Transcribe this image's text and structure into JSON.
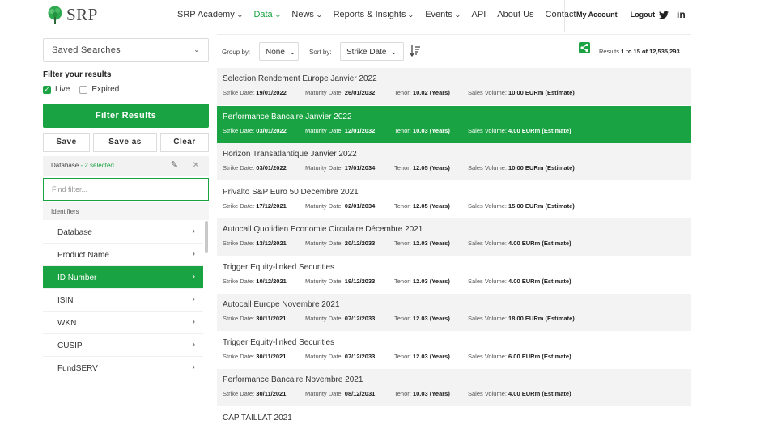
{
  "header": {
    "logo_text": "SRP",
    "nav": [
      {
        "label": "SRP Academy",
        "caret": true,
        "active": false
      },
      {
        "label": "Data",
        "caret": true,
        "active": true
      },
      {
        "label": "News",
        "caret": true,
        "active": false
      },
      {
        "label": "Reports & Insights",
        "caret": true,
        "active": false
      },
      {
        "label": "Events",
        "caret": true,
        "active": false
      },
      {
        "label": "API",
        "caret": false,
        "active": false
      },
      {
        "label": "About Us",
        "caret": false,
        "active": false
      },
      {
        "label": "Contact",
        "caret": false,
        "active": false
      }
    ],
    "my_account": "My Account",
    "logout": "Logout",
    "twitter_glyph": "🐦",
    "linkedin_glyph": "in"
  },
  "sidebar": {
    "saved_searches": "Saved Searches",
    "filter_title": "Filter your results",
    "live_label": "Live",
    "live_checked": true,
    "expired_label": "Expired",
    "expired_checked": false,
    "filter_button": "Filter Results",
    "save_label": "Save",
    "save_as_label": "Save as",
    "clear_label": "Clear",
    "database_label": "Database",
    "database_selected": "- 2 selected",
    "find_placeholder": "Find filter...",
    "section_identifiers": "Identifiers",
    "filters": [
      {
        "label": "Database",
        "active": false
      },
      {
        "label": "Product Name",
        "active": false
      },
      {
        "label": "ID Number",
        "active": true
      },
      {
        "label": "ISIN",
        "active": false
      },
      {
        "label": "WKN",
        "active": false
      },
      {
        "label": "CUSIP",
        "active": false
      },
      {
        "label": "FundSERV",
        "active": false
      }
    ]
  },
  "toolbar": {
    "group_by_label": "Group by:",
    "group_by_value": "None",
    "sort_by_label": "Sort by:",
    "sort_by_value": "Strike Date",
    "results_prefix": "Results",
    "results_range": "1 to 15 of 12,535,293"
  },
  "meta_labels": {
    "strike": "Strike Date:",
    "maturity": "Maturity Date:",
    "tenor": "Tenor:",
    "volume": "Sales Volume:"
  },
  "results": [
    {
      "title": "Selection Rendement Europe Janvier 2022",
      "strike": "19/01/2022",
      "maturity": "26/01/2032",
      "tenor": "10.02 (Years)",
      "volume": "10.00 EURm (Estimate)",
      "style": "shaded"
    },
    {
      "title": "Performance Bancaire Janvier 2022",
      "strike": "03/01/2022",
      "maturity": "12/01/2032",
      "tenor": "10.03 (Years)",
      "volume": "4.00 EURm (Estimate)",
      "style": "active"
    },
    {
      "title": "Horizon Transatlantique Janvier 2022",
      "strike": "03/01/2022",
      "maturity": "17/01/2034",
      "tenor": "12.05 (Years)",
      "volume": "10.00 EURm (Estimate)",
      "style": "shaded"
    },
    {
      "title": "Privalto S&P Euro 50 Decembre 2021",
      "strike": "17/12/2021",
      "maturity": "02/01/2034",
      "tenor": "12.05 (Years)",
      "volume": "15.00 EURm (Estimate)",
      "style": "plain"
    },
    {
      "title": "Autocall Quotidien Economie Circulaire Décembre 2021",
      "strike": "13/12/2021",
      "maturity": "20/12/2033",
      "tenor": "12.03 (Years)",
      "volume": "4.00 EURm (Estimate)",
      "style": "shaded"
    },
    {
      "title": "Trigger Equity-linked Securities",
      "strike": "10/12/2021",
      "maturity": "19/12/2033",
      "tenor": "12.03 (Years)",
      "volume": "4.00 EURm (Estimate)",
      "style": "plain"
    },
    {
      "title": "Autocall Europe Novembre 2021",
      "strike": "30/11/2021",
      "maturity": "07/12/2033",
      "tenor": "12.03 (Years)",
      "volume": "18.00 EURm (Estimate)",
      "style": "shaded"
    },
    {
      "title": "Trigger Equity-linked Securities",
      "strike": "30/11/2021",
      "maturity": "07/12/2033",
      "tenor": "12.03 (Years)",
      "volume": "6.00 EURm (Estimate)",
      "style": "plain"
    },
    {
      "title": "Performance Bancaire Novembre 2021",
      "strike": "30/11/2021",
      "maturity": "08/12/2031",
      "tenor": "10.03 (Years)",
      "volume": "4.00 EURm (Estimate)",
      "style": "shaded"
    },
    {
      "title": "CAP TAILLAT 2021",
      "strike": "",
      "maturity": "",
      "tenor": "",
      "volume": "",
      "style": "plain"
    }
  ]
}
